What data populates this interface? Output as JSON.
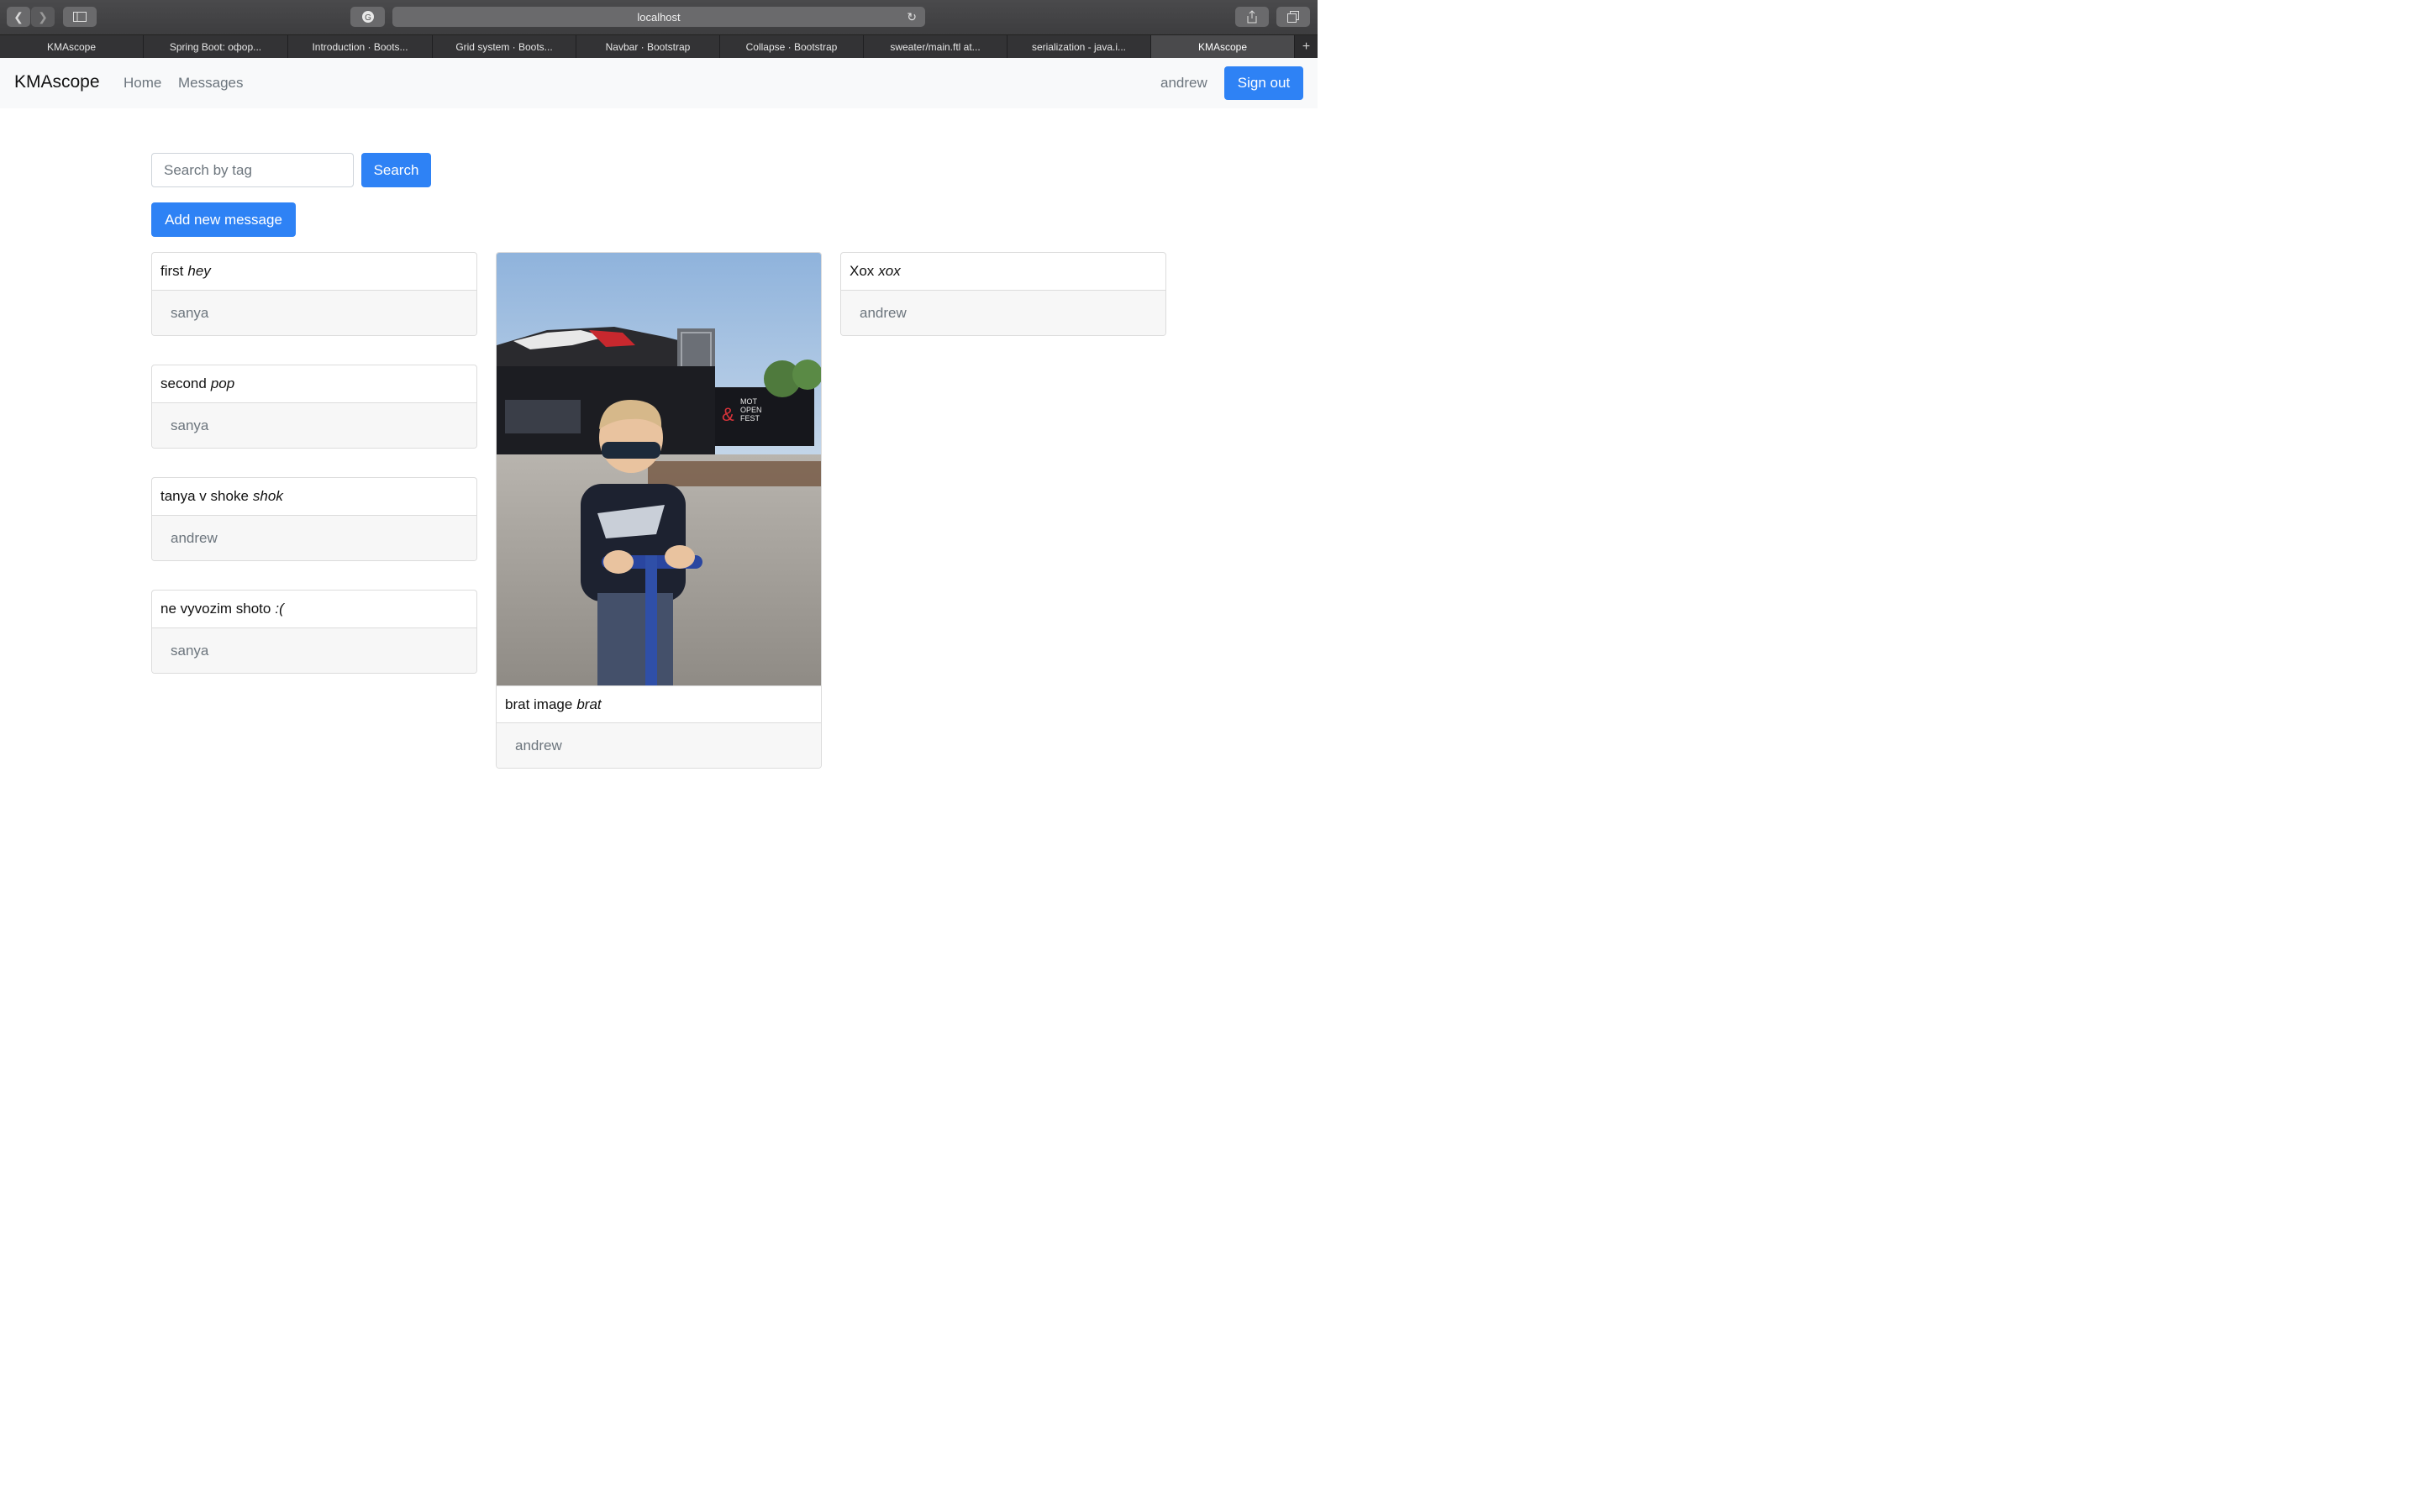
{
  "browser": {
    "url": "localhost",
    "tabs": [
      {
        "label": "KMAscope",
        "active": false
      },
      {
        "label": "Spring Boot: офор...",
        "active": false
      },
      {
        "label": "Introduction · Boots...",
        "active": false
      },
      {
        "label": "Grid system · Boots...",
        "active": false
      },
      {
        "label": "Navbar · Bootstrap",
        "active": false
      },
      {
        "label": "Collapse · Bootstrap",
        "active": false
      },
      {
        "label": "sweater/main.ftl at...",
        "active": false
      },
      {
        "label": "serialization - java.i...",
        "active": false
      },
      {
        "label": "KMAscope",
        "active": true
      }
    ],
    "new_tab_label": "+"
  },
  "navbar": {
    "brand": "KMAscope",
    "links": [
      "Home",
      "Messages"
    ],
    "username": "andrew",
    "signout_label": "Sign out"
  },
  "search": {
    "placeholder": "Search by tag",
    "button_label": "Search"
  },
  "add_button_label": "Add new message",
  "messages": [
    {
      "text": "first",
      "tag": "hey",
      "author": "sanya",
      "has_image": false
    },
    {
      "text": "second",
      "tag": "pop",
      "author": "sanya",
      "has_image": false
    },
    {
      "text": "tanya v shoke",
      "tag": "shok",
      "author": "andrew",
      "has_image": false
    },
    {
      "text": "ne vyvozim shoto",
      "tag": ":(",
      "author": "sanya",
      "has_image": false
    },
    {
      "text": "brat image",
      "tag": "brat",
      "author": "andrew",
      "has_image": true
    },
    {
      "text": "Xox",
      "tag": "xox",
      "author": "andrew",
      "has_image": false
    }
  ],
  "colors": {
    "primary": "#2e82f5",
    "navbar_bg": "#f8f9fa",
    "muted": "#6c757d"
  }
}
